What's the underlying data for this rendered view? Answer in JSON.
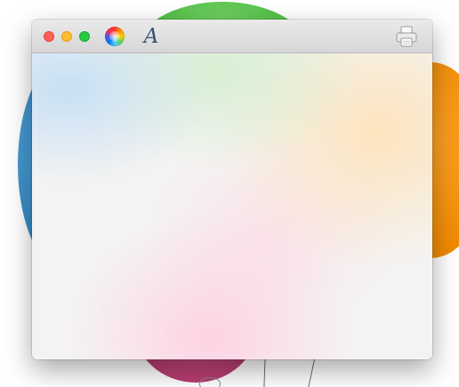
{
  "window": {
    "traffic_lights": [
      "close",
      "minimize",
      "zoom"
    ],
    "toolbar": {
      "color_picker_icon": "color-wheel-icon",
      "font_icon": "font-italic-a-icon",
      "font_glyph": "A",
      "print_icon": "printer-icon"
    }
  },
  "colors": {
    "close": "#fe5f57",
    "minimize": "#febc2e",
    "zoom": "#28c840",
    "font_glyph": "#3c4f78"
  }
}
